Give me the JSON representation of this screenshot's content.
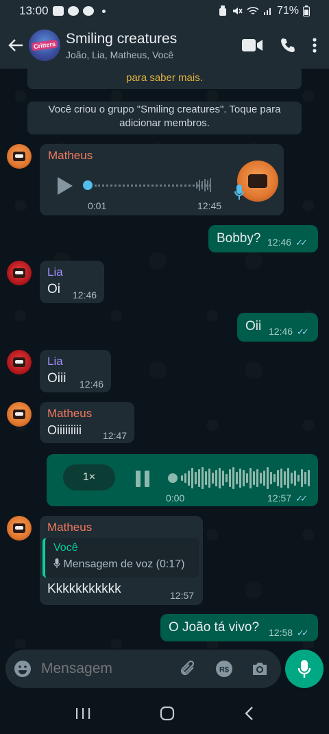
{
  "status_bar": {
    "time": "13:00",
    "battery": "71%"
  },
  "header": {
    "title": "Smiling creatures",
    "members": "João, Lia, Matheus, Você",
    "avatar_logo": "Critters"
  },
  "system_messages": {
    "encryption_tail": "para saber mais.",
    "created": "Você criou o grupo \"Smiling creatures\". Toque para adicionar membros."
  },
  "messages": [
    {
      "type": "voice_in",
      "sender": "Matheus",
      "elapsed": "0:01",
      "time": "12:45"
    },
    {
      "type": "text_out",
      "text": "Bobby?",
      "time": "12:46"
    },
    {
      "type": "text_in",
      "sender": "Lia",
      "text": "Oi",
      "time": "12:46"
    },
    {
      "type": "text_out",
      "text": "Oii",
      "time": "12:46"
    },
    {
      "type": "text_in",
      "sender": "Lia",
      "text": "Oiii",
      "time": "12:46"
    },
    {
      "type": "text_in",
      "sender": "Matheus",
      "text": "Oiiiiiiiii",
      "time": "12:47"
    },
    {
      "type": "voice_out",
      "speed": "1×",
      "elapsed": "0:00",
      "time": "12:57"
    },
    {
      "type": "reply_in",
      "sender": "Matheus",
      "quote_author": "Você",
      "quote_text": "Mensagem de voz (0:17)",
      "text": "Kkkkkkkkkkk",
      "time": "12:57"
    },
    {
      "type": "text_out",
      "text": "O João tá vivo?",
      "time": "12:58"
    }
  ],
  "composer": {
    "placeholder": "Mensagem"
  },
  "colors": {
    "background": "#0b141a",
    "bubble_in": "#1f2c34",
    "bubble_out": "#005c4b",
    "accent": "#00a884",
    "sender_matheus": "#f1795f",
    "sender_lia": "#a191fa",
    "read_ticks": "#8fd0f0"
  },
  "voice_out_progress": 0
}
